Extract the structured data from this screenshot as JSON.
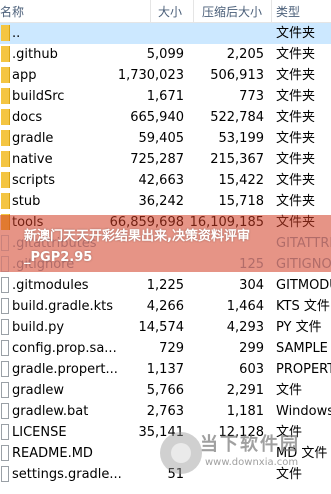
{
  "header": {
    "name": "名称",
    "size": "大小",
    "compressed": "压缩后大小",
    "type": "类型"
  },
  "rows": [
    {
      "name": "..",
      "size": "",
      "compressed": "",
      "type": "文件夹",
      "kind": "folder"
    },
    {
      "name": ".github",
      "size": "5,099",
      "compressed": "2,205",
      "type": "文件夹",
      "kind": "folder"
    },
    {
      "name": "app",
      "size": "1,730,023",
      "compressed": "506,913",
      "type": "文件夹",
      "kind": "folder"
    },
    {
      "name": "buildSrc",
      "size": "1,671",
      "compressed": "773",
      "type": "文件夹",
      "kind": "folder"
    },
    {
      "name": "docs",
      "size": "665,940",
      "compressed": "522,784",
      "type": "文件夹",
      "kind": "folder"
    },
    {
      "name": "gradle",
      "size": "59,405",
      "compressed": "53,199",
      "type": "文件夹",
      "kind": "folder"
    },
    {
      "name": "native",
      "size": "725,287",
      "compressed": "215,367",
      "type": "文件夹",
      "kind": "folder"
    },
    {
      "name": "scripts",
      "size": "42,663",
      "compressed": "15,422",
      "type": "文件夹",
      "kind": "folder"
    },
    {
      "name": "stub",
      "size": "36,242",
      "compressed": "15,718",
      "type": "文件夹",
      "kind": "folder"
    },
    {
      "name": "tools",
      "size": "66,859,698",
      "compressed": "16,109,185",
      "type": "文件夹",
      "kind": "folder"
    },
    {
      "name": ".gitattributes",
      "size": "",
      "compressed": "",
      "type": "GITATTRI",
      "kind": "git"
    },
    {
      "name": ".gitignore",
      "size": "",
      "compressed": "125",
      "type": "GITIGNOR",
      "kind": "git"
    },
    {
      "name": ".gitmodules",
      "size": "1,225",
      "compressed": "304",
      "type": "GITMODU",
      "kind": "file"
    },
    {
      "name": "build.gradle.kts",
      "size": "4,266",
      "compressed": "1,464",
      "type": "KTS 文件",
      "kind": "file"
    },
    {
      "name": "build.py",
      "size": "14,574",
      "compressed": "4,293",
      "type": "PY 文件",
      "kind": "file"
    },
    {
      "name": "config.prop.sa...",
      "size": "729",
      "compressed": "299",
      "type": "SAMPLE 文",
      "kind": "file"
    },
    {
      "name": "gradle.propert...",
      "size": "1,137",
      "compressed": "603",
      "type": "PROPERT",
      "kind": "file"
    },
    {
      "name": "gradlew",
      "size": "5,766",
      "compressed": "2,291",
      "type": "文件",
      "kind": "file"
    },
    {
      "name": "gradlew.bat",
      "size": "2,763",
      "compressed": "1,181",
      "type": "Windows",
      "kind": "file"
    },
    {
      "name": "LICENSE",
      "size": "35,141",
      "compressed": "12,128",
      "type": "文件",
      "kind": "file"
    },
    {
      "name": "README.MD",
      "size": "",
      "compressed": "",
      "type": "MD 文件",
      "kind": "file"
    },
    {
      "name": "settings.gradle...",
      "size": "51",
      "compressed": "",
      "type": "文件",
      "kind": "file"
    }
  ],
  "overlay": {
    "text": "新澳门天天开彩结果出来,决策资料评审_PGP2.95"
  },
  "watermark": {
    "text": "当下软件园",
    "url": "www.downxia.com"
  }
}
